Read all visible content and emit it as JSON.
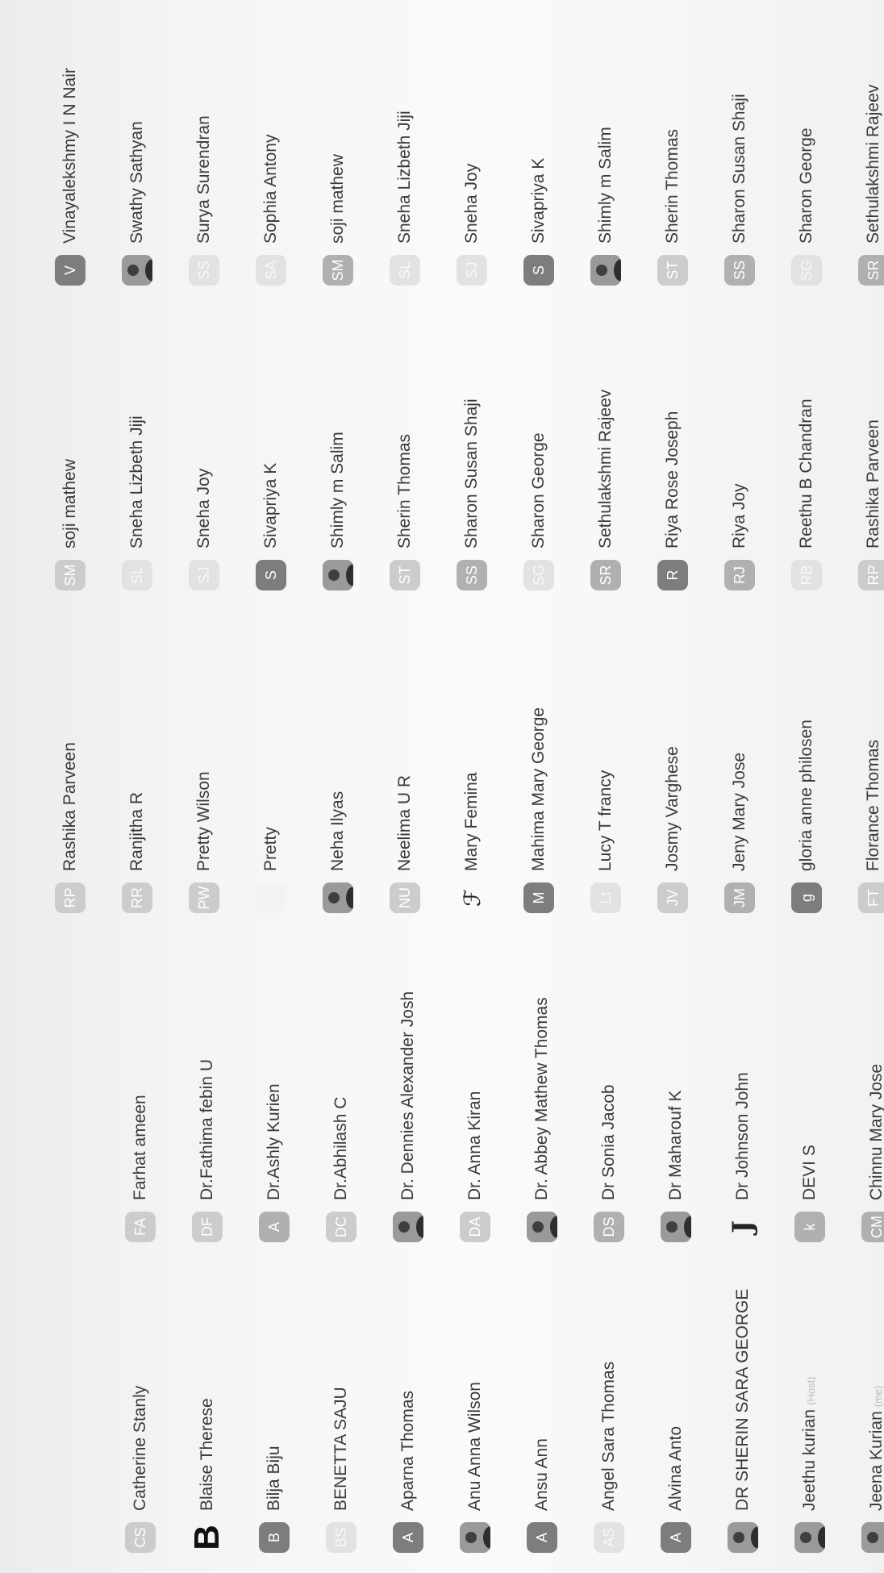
{
  "participants": {
    "column_1": [
      {
        "name": "Jeena Kurian",
        "tag": "(me)",
        "avatar": {
          "kind": "photo",
          "icon": "profile-photo-icon"
        }
      },
      {
        "name": "Jeethu kurian",
        "tag": "(Host)",
        "avatar": {
          "kind": "photo",
          "icon": "organization-logo-icon"
        }
      },
      {
        "name": "DR SHERIN SARA GEORGE",
        "avatar": {
          "kind": "photo",
          "icon": "profile-photo-icon"
        }
      },
      {
        "name": "Alvina Anto",
        "avatar": {
          "kind": "initials",
          "text": "A",
          "tone": "dark"
        }
      },
      {
        "name": "Angel Sara Thomas",
        "avatar": {
          "kind": "initials",
          "text": "AS",
          "tone": "vlight"
        }
      },
      {
        "name": "Ansu Ann",
        "avatar": {
          "kind": "initials",
          "text": "A",
          "tone": "dark"
        }
      },
      {
        "name": "Anu Anna Wilson",
        "avatar": {
          "kind": "photo",
          "icon": "profile-photo-icon"
        }
      },
      {
        "name": "Aparna Thomas",
        "avatar": {
          "kind": "initials",
          "text": "A",
          "tone": "dark"
        }
      },
      {
        "name": "BENETTA SAJU",
        "avatar": {
          "kind": "initials",
          "text": "BS",
          "tone": "vlight"
        }
      },
      {
        "name": "Bilja Biju",
        "avatar": {
          "kind": "initials",
          "text": "B",
          "tone": "dark"
        }
      },
      {
        "name": "Blaise Therese",
        "avatar": {
          "kind": "glyph",
          "text": "B",
          "style": "g-b"
        }
      },
      {
        "name": "Catherine Stanly",
        "avatar": {
          "kind": "initials",
          "text": "CS",
          "tone": "light"
        }
      }
    ],
    "column_2": [
      {
        "name": "Chinnu Mary Jose",
        "avatar": {
          "kind": "initials",
          "text": "CM",
          "tone": "mid"
        }
      },
      {
        "name": "DEVI S",
        "avatar": {
          "kind": "initials",
          "text": "k",
          "tone": "mid"
        }
      },
      {
        "name": "Dr Johnson John",
        "avatar": {
          "kind": "glyph",
          "text": "J",
          "style": "g-j"
        }
      },
      {
        "name": "Dr Maharouf K",
        "avatar": {
          "kind": "photo",
          "icon": "profile-photo-icon"
        }
      },
      {
        "name": "Dr Sonia Jacob",
        "avatar": {
          "kind": "initials",
          "text": "DS",
          "tone": "mid"
        }
      },
      {
        "name": "Dr. Abbey Mathew Thomas",
        "avatar": {
          "kind": "photo",
          "icon": "profile-photo-icon"
        }
      },
      {
        "name": "Dr. Anna Kiran",
        "avatar": {
          "kind": "initials",
          "text": "DA",
          "tone": "light"
        }
      },
      {
        "name": "Dr. Dennies Alexander Josh",
        "avatar": {
          "kind": "photo",
          "icon": "profile-photo-icon"
        }
      },
      {
        "name": "Dr.Abhilash C",
        "avatar": {
          "kind": "initials",
          "text": "DC",
          "tone": "light"
        }
      },
      {
        "name": "Dr.Ashly Kurien",
        "avatar": {
          "kind": "initials",
          "text": "A",
          "tone": "mid"
        }
      },
      {
        "name": "Dr.Fathima febin U",
        "avatar": {
          "kind": "initials",
          "text": "DF",
          "tone": "light"
        }
      },
      {
        "name": "Farhat ameen",
        "avatar": {
          "kind": "initials",
          "text": "FA",
          "tone": "light"
        }
      }
    ],
    "column_3": [
      {
        "name": "Florance Thomas",
        "avatar": {
          "kind": "initials",
          "text": "FT",
          "tone": "light"
        }
      },
      {
        "name": "gloria anne philosen",
        "avatar": {
          "kind": "initials",
          "text": "g",
          "tone": "dark"
        }
      },
      {
        "name": "Jeny Mary Jose",
        "avatar": {
          "kind": "initials",
          "text": "JM",
          "tone": "mid"
        }
      },
      {
        "name": "Josmy Varghese",
        "avatar": {
          "kind": "initials",
          "text": "JV",
          "tone": "light"
        }
      },
      {
        "name": "Lucy T francy",
        "avatar": {
          "kind": "initials",
          "text": "Lt",
          "tone": "vlight"
        }
      },
      {
        "name": "Mahima Mary George",
        "avatar": {
          "kind": "initials",
          "text": "M",
          "tone": "dark"
        }
      },
      {
        "name": "Mary Femina",
        "avatar": {
          "kind": "glyph",
          "text": "ℱ",
          "style": "g-script"
        }
      },
      {
        "name": "Neelima U R",
        "avatar": {
          "kind": "initials",
          "text": "NU",
          "tone": "light"
        }
      },
      {
        "name": "Neha Ilyas",
        "avatar": {
          "kind": "photo",
          "icon": "profile-photo-icon"
        }
      },
      {
        "name": "Pretty",
        "avatar": {
          "kind": "blank",
          "icon": "blank-avatar-icon"
        }
      },
      {
        "name": "Pretty Wilson",
        "avatar": {
          "kind": "initials",
          "text": "PW",
          "tone": "light"
        }
      },
      {
        "name": "Ranjitha R",
        "avatar": {
          "kind": "initials",
          "text": "RR",
          "tone": "light"
        }
      },
      {
        "name": "Rashika Parveen",
        "avatar": {
          "kind": "initials",
          "text": "RP",
          "tone": "light"
        }
      }
    ],
    "column_4": [
      {
        "name": "Rashika Parveen",
        "avatar": {
          "kind": "initials",
          "text": "RP",
          "tone": "light"
        }
      },
      {
        "name": "Reethu B Chandran",
        "avatar": {
          "kind": "initials",
          "text": "RB",
          "tone": "vlight"
        }
      },
      {
        "name": "Riya Joy",
        "avatar": {
          "kind": "initials",
          "text": "RJ",
          "tone": "mid"
        }
      },
      {
        "name": "Riya Rose Joseph",
        "avatar": {
          "kind": "initials",
          "text": "R",
          "tone": "dark"
        }
      },
      {
        "name": "Sethulakshmi Rajeev",
        "avatar": {
          "kind": "initials",
          "text": "SR",
          "tone": "mid"
        }
      },
      {
        "name": "Sharon George",
        "avatar": {
          "kind": "initials",
          "text": "SG",
          "tone": "vlight"
        }
      },
      {
        "name": "Sharon Susan Shaji",
        "avatar": {
          "kind": "initials",
          "text": "SS",
          "tone": "mid"
        }
      },
      {
        "name": "Sherin Thomas",
        "avatar": {
          "kind": "initials",
          "text": "ST",
          "tone": "light"
        }
      },
      {
        "name": "Shimly m Salim",
        "avatar": {
          "kind": "photo",
          "icon": "profile-photo-icon"
        }
      },
      {
        "name": "Sivapriya K",
        "avatar": {
          "kind": "initials",
          "text": "S",
          "tone": "dark"
        }
      },
      {
        "name": "Sneha Joy",
        "avatar": {
          "kind": "initials",
          "text": "SJ",
          "tone": "vlight"
        }
      },
      {
        "name": "Sneha Lizbeth Jiji",
        "avatar": {
          "kind": "initials",
          "text": "SL",
          "tone": "vlight"
        }
      },
      {
        "name": "soji mathew",
        "avatar": {
          "kind": "initials",
          "text": "SM",
          "tone": "light"
        }
      }
    ],
    "column_5": [
      {
        "name": "Sethulakshmi Rajeev",
        "avatar": {
          "kind": "initials",
          "text": "SR",
          "tone": "mid"
        }
      },
      {
        "name": "Sharon George",
        "avatar": {
          "kind": "initials",
          "text": "SG",
          "tone": "vlight"
        }
      },
      {
        "name": "Sharon Susan Shaji",
        "avatar": {
          "kind": "initials",
          "text": "SS",
          "tone": "mid"
        }
      },
      {
        "name": "Sherin Thomas",
        "avatar": {
          "kind": "initials",
          "text": "ST",
          "tone": "light"
        }
      },
      {
        "name": "Shimly m Salim",
        "avatar": {
          "kind": "photo",
          "icon": "profile-photo-icon"
        }
      },
      {
        "name": "Sivapriya K",
        "avatar": {
          "kind": "initials",
          "text": "S",
          "tone": "dark"
        }
      },
      {
        "name": "Sneha Joy",
        "avatar": {
          "kind": "initials",
          "text": "SJ",
          "tone": "vlight"
        }
      },
      {
        "name": "Sneha Lizbeth Jiji",
        "avatar": {
          "kind": "initials",
          "text": "SL",
          "tone": "vlight"
        }
      },
      {
        "name": "soji mathew",
        "avatar": {
          "kind": "initials",
          "text": "SM",
          "tone": "mid"
        }
      },
      {
        "name": "Sophia Antony",
        "avatar": {
          "kind": "initials",
          "text": "SA",
          "tone": "vlight"
        }
      },
      {
        "name": "Surya Surendran",
        "avatar": {
          "kind": "initials",
          "text": "SS",
          "tone": "vlight"
        }
      },
      {
        "name": "Swathy Sathyan",
        "avatar": {
          "kind": "photo",
          "icon": "profile-photo-icon"
        }
      },
      {
        "name": "Vinayalekshmy I N Nair",
        "avatar": {
          "kind": "initials",
          "text": "V",
          "tone": "dark"
        }
      }
    ]
  }
}
